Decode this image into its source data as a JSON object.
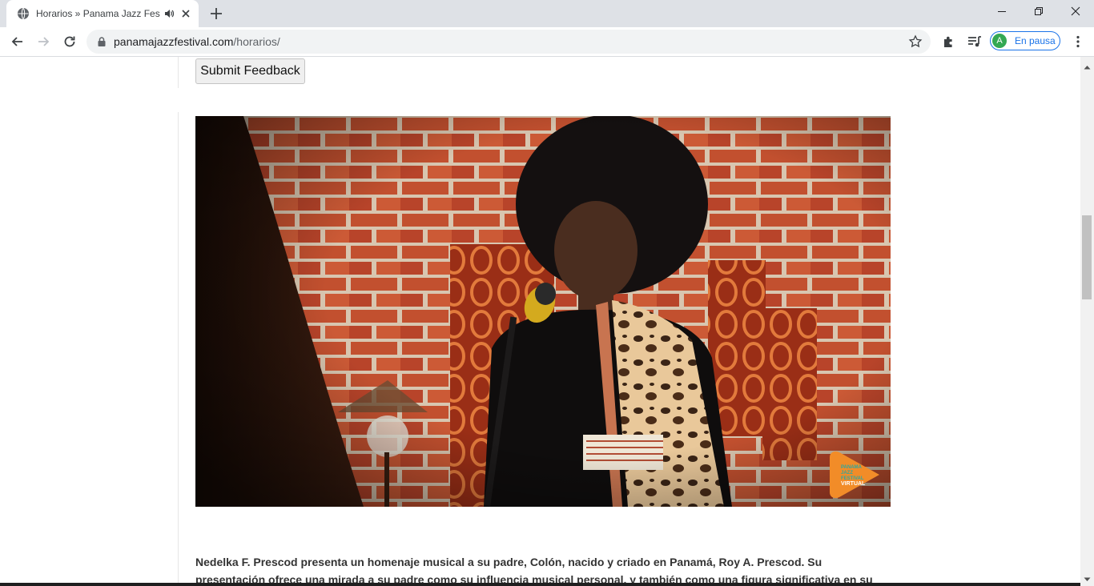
{
  "browser": {
    "tab": {
      "title": "Horarios » Panama Jazz Festi",
      "favicon": "globe-icon",
      "audio_icon": "speaker-playing-icon",
      "close_icon": "close-icon"
    },
    "new_tab_icon": "plus-icon",
    "window_controls": [
      "minimize-icon",
      "maximize-icon",
      "close-icon"
    ],
    "nav": {
      "back_icon": "arrow-left-icon",
      "forward_icon": "arrow-right-icon",
      "reload_icon": "reload-icon"
    },
    "address": {
      "host": "panamajazzfestival.com",
      "path": "/horarios/",
      "lock_icon": "lock-icon",
      "bookmark_icon": "star-icon"
    },
    "extensions_icon": "puzzle-icon",
    "media_icon": "media-queue-icon",
    "profile": {
      "initial": "A",
      "status": "En pausa",
      "avatar_color": "#34a853"
    },
    "menu_icon": "kebab-menu-icon"
  },
  "page": {
    "feedback_button": "Submit Feedback",
    "video": {
      "subject": "singer-performing-at-microphone",
      "badge_lines": [
        "PANAMA",
        "JAZZ",
        "FESTIVAL",
        "VIRTUAL"
      ],
      "badge_color": "#f28c28"
    },
    "description": "Nedelka F. Prescod presenta un homenaje musical a su padre, Colón, nacido y criado en Panamá, Roy A. Prescod. Su presentación ofrece una mirada a su padre como su influencia musical personal, y también como una figura significativa en su"
  },
  "colors": {
    "tabstrip": "#dee1e6",
    "accent": "#1a73e8"
  }
}
